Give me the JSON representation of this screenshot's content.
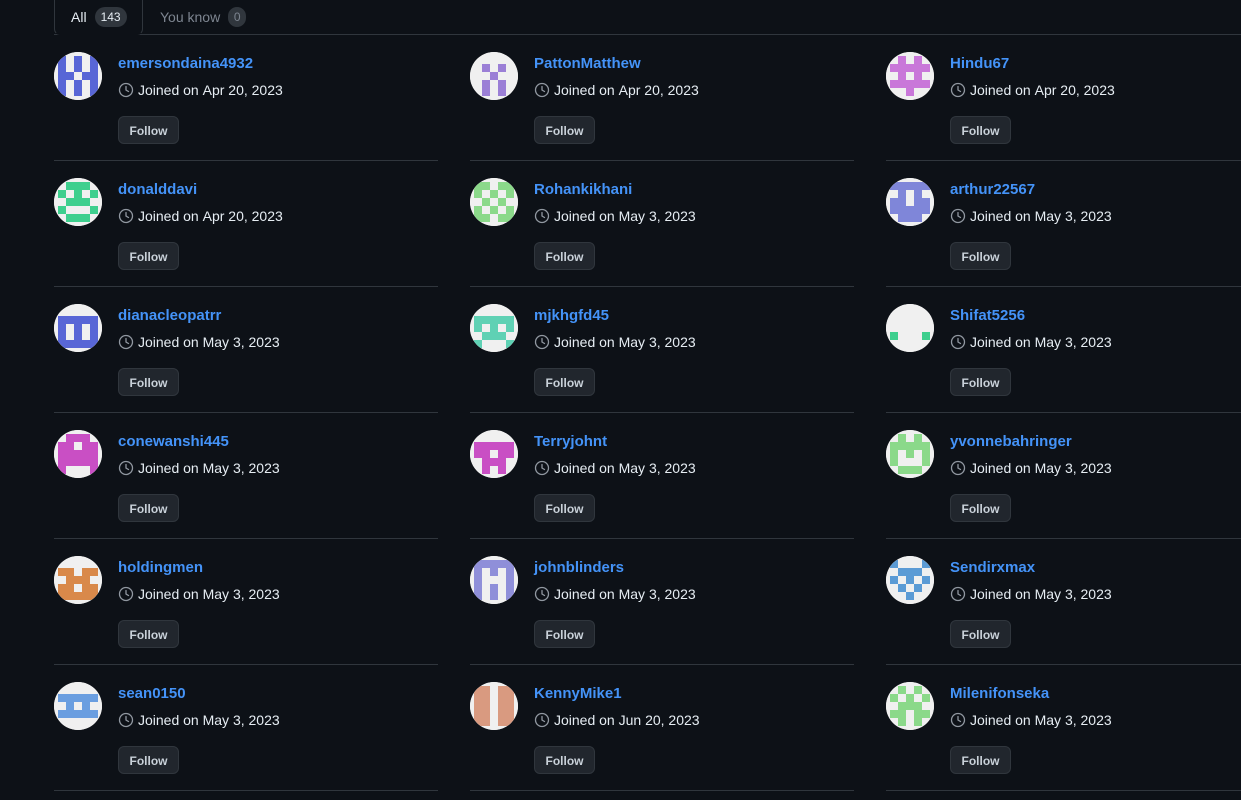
{
  "tabs": [
    {
      "label": "All",
      "count": "143"
    },
    {
      "label": "You know",
      "count": "0"
    }
  ],
  "follow_label": "Follow",
  "joined_prefix": "Joined on",
  "users": [
    {
      "username": "emersondaina4932",
      "joined": "Apr 20, 2023",
      "avatar_color": "#5866d6",
      "pattern": [
        "10101",
        "10101",
        "11011",
        "10101",
        "10101"
      ]
    },
    {
      "username": "PattonMatthew",
      "joined": "Apr 20, 2023",
      "avatar_color": "#9b7fd6",
      "pattern": [
        "00000",
        "01010",
        "00100",
        "01010",
        "01010"
      ]
    },
    {
      "username": "Hindu67",
      "joined": "Apr 20, 2023",
      "avatar_color": "#c977d9",
      "pattern": [
        "01010",
        "11111",
        "01010",
        "11111",
        "00100"
      ]
    },
    {
      "username": "donalddavi",
      "joined": "Apr 20, 2023",
      "avatar_color": "#3ecf8e",
      "pattern": [
        "01110",
        "10101",
        "01110",
        "10001",
        "01110"
      ]
    },
    {
      "username": "Rohankikhani",
      "joined": "May 3, 2023",
      "avatar_color": "#8bd98a",
      "pattern": [
        "11011",
        "10101",
        "01010",
        "10101",
        "11011"
      ]
    },
    {
      "username": "arthur22567",
      "joined": "May 3, 2023",
      "avatar_color": "#7f86d9",
      "pattern": [
        "11111",
        "01010",
        "11011",
        "11111",
        "01110"
      ]
    },
    {
      "username": "dianacleopatrr",
      "joined": "May 3, 2023",
      "avatar_color": "#5866d6",
      "pattern": [
        "00000",
        "11111",
        "10101",
        "10101",
        "11111"
      ]
    },
    {
      "username": "mjkhgfd45",
      "joined": "May 3, 2023",
      "avatar_color": "#5fd1b4",
      "pattern": [
        "00000",
        "11111",
        "10101",
        "01110",
        "10001"
      ]
    },
    {
      "username": "Shifat5256",
      "joined": "May 3, 2023",
      "avatar_color": "#3ecf8e",
      "pattern": [
        "00000",
        "00000",
        "00000",
        "10001",
        "00000"
      ]
    },
    {
      "username": "conewanshi445",
      "joined": "May 3, 2023",
      "avatar_color": "#c94fc4",
      "pattern": [
        "01110",
        "11011",
        "11111",
        "11111",
        "10001"
      ]
    },
    {
      "username": "Terryjohnt",
      "joined": "May 3, 2023",
      "avatar_color": "#c94fc4",
      "pattern": [
        "00000",
        "11111",
        "11011",
        "01110",
        "01010"
      ]
    },
    {
      "username": "yvonnebahringer",
      "joined": "May 3, 2023",
      "avatar_color": "#8bd98a",
      "pattern": [
        "01010",
        "11111",
        "10101",
        "10001",
        "01110"
      ]
    },
    {
      "username": "holdingmen",
      "joined": "May 3, 2023",
      "avatar_color": "#d9894a",
      "pattern": [
        "00000",
        "11011",
        "01110",
        "11011",
        "11111"
      ]
    },
    {
      "username": "johnblinders",
      "joined": "May 3, 2023",
      "avatar_color": "#8f8fd9",
      "pattern": [
        "11111",
        "10101",
        "10001",
        "10101",
        "10101"
      ]
    },
    {
      "username": "Sendirxmax",
      "joined": "May 3, 2023",
      "avatar_color": "#5b9bd5",
      "pattern": [
        "10001",
        "01110",
        "10101",
        "01010",
        "00100"
      ]
    },
    {
      "username": "sean0150",
      "joined": "May 3, 2023",
      "avatar_color": "#6a9ee0",
      "pattern": [
        "00000",
        "11111",
        "01010",
        "11111",
        "00000"
      ]
    },
    {
      "username": "KennyMike1",
      "joined": "Jun 20, 2023",
      "avatar_color": "#d99a80",
      "pattern": [
        "11011",
        "11011",
        "11011",
        "11011",
        "11011"
      ]
    },
    {
      "username": "Milenifonseka",
      "joined": "May 3, 2023",
      "avatar_color": "#8bd98a",
      "pattern": [
        "01010",
        "10101",
        "01110",
        "11011",
        "01010"
      ]
    }
  ]
}
